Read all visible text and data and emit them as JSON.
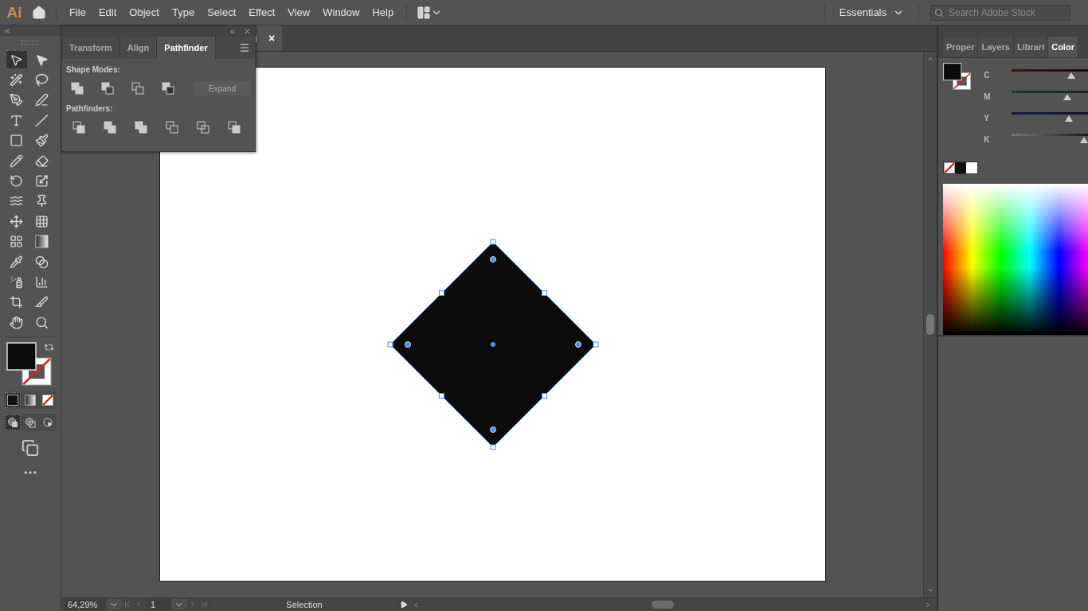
{
  "app_logo": "Ai",
  "menu": [
    "File",
    "Edit",
    "Object",
    "Type",
    "Select",
    "Effect",
    "View",
    "Window",
    "Help"
  ],
  "workspace": {
    "label": "Essentials"
  },
  "search": {
    "placeholder": "Search Adobe Stock"
  },
  "document_tab": {
    "title": ")",
    "close": "×"
  },
  "tools": [
    {
      "kind": "selection",
      "selected": true
    },
    {
      "kind": "direct",
      "selected": false
    },
    {
      "kind": "wand",
      "selected": false
    },
    {
      "kind": "lasso",
      "selected": false
    },
    {
      "kind": "pen",
      "selected": false
    },
    {
      "kind": "curvature",
      "selected": false
    },
    {
      "kind": "type",
      "selected": false
    },
    {
      "kind": "line",
      "selected": false
    },
    {
      "kind": "rectangle",
      "selected": false
    },
    {
      "kind": "brush",
      "selected": false
    },
    {
      "kind": "shaper",
      "selected": false
    },
    {
      "kind": "eraser",
      "selected": false
    },
    {
      "kind": "rotate",
      "selected": false
    },
    {
      "kind": "scale",
      "selected": false
    },
    {
      "kind": "warp",
      "selected": false
    },
    {
      "kind": "puppet",
      "selected": false
    },
    {
      "kind": "transform",
      "selected": false
    },
    {
      "kind": "perspective",
      "selected": false
    },
    {
      "kind": "mesh",
      "selected": false
    },
    {
      "kind": "gradient",
      "selected": false
    },
    {
      "kind": "eyedropper",
      "selected": false
    },
    {
      "kind": "blend",
      "selected": false
    },
    {
      "kind": "symbol",
      "selected": false
    },
    {
      "kind": "graph",
      "selected": false
    },
    {
      "kind": "artboard",
      "selected": false
    },
    {
      "kind": "slice",
      "selected": false
    },
    {
      "kind": "hand",
      "selected": false
    },
    {
      "kind": "zoom",
      "selected": false
    }
  ],
  "color_modes": [
    {
      "kind": "color",
      "selected": true
    },
    {
      "kind": "gradient",
      "selected": false
    },
    {
      "kind": "none",
      "selected": false
    }
  ],
  "draw_modes": [
    {
      "kind": "normal",
      "selected": true
    },
    {
      "kind": "behind",
      "selected": false
    },
    {
      "kind": "inside",
      "selected": false
    }
  ],
  "pathfinder_panel": {
    "tabs": [
      {
        "label": "Transform",
        "selected": false
      },
      {
        "label": "Align",
        "selected": false
      },
      {
        "label": "Pathfinder",
        "selected": true
      }
    ],
    "shape_modes": {
      "title": "Shape Modes:",
      "expand_button": {
        "label": "Expand",
        "disabled": true
      }
    },
    "pathfinders": {
      "title": "Pathfinders:"
    }
  },
  "right_panel": {
    "tabs": [
      {
        "label": "Proper",
        "selected": false
      },
      {
        "label": "Layers",
        "selected": false
      },
      {
        "label": "Librari",
        "selected": false
      },
      {
        "label": "Color",
        "selected": true
      }
    ],
    "sliders": [
      {
        "label": "C",
        "level": 0.71
      },
      {
        "label": "M",
        "level": 0.66
      },
      {
        "label": "Y",
        "level": 0.68
      },
      {
        "label": "K",
        "level": 0.86
      }
    ]
  },
  "status_bar": {
    "zoom": "64,29%",
    "artboard": "1",
    "tool": "Selection"
  }
}
